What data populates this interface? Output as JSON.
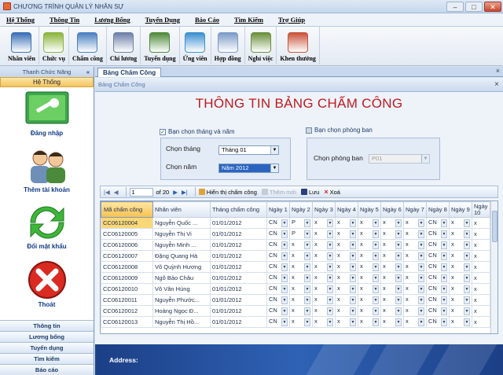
{
  "window": {
    "title": "CHƯƠNG TRÌNH QUẢN LÝ NHÂN SỰ",
    "minimize": "–",
    "maximize": "□",
    "close": "✕"
  },
  "menu": [
    "Hệ Thống",
    "Thông Tin",
    "Lương Bổng",
    "Tuyển Dụng",
    "Báo Cáo",
    "Tìm Kiếm",
    "Trợ Giúp"
  ],
  "toolbar": [
    {
      "label": "Nhân viên",
      "icon": "employee-icon",
      "color": "#3a6fb5"
    },
    {
      "label": "Chức vụ",
      "icon": "position-icon",
      "color": "#8ab43a"
    },
    {
      "label": "Chấm công",
      "icon": "timesheet-icon",
      "color": "#4a7fc1"
    },
    {
      "label": "Chi lương",
      "icon": "payroll-icon",
      "color": "#6d7fa8"
    },
    {
      "label": "Tuyển dụng",
      "icon": "recruitment-icon",
      "color": "#4f8a3a"
    },
    {
      "label": "Ứng viên",
      "icon": "candidate-icon",
      "color": "#3c8fcf"
    },
    {
      "label": "Hợp đồng",
      "icon": "contract-icon",
      "color": "#7c9bc8"
    },
    {
      "label": "Nghỉ việc",
      "icon": "resign-icon",
      "color": "#6a8f3c"
    },
    {
      "label": "Khen thưởng",
      "icon": "reward-icon",
      "color": "#c9533a"
    }
  ],
  "sidebar": {
    "header": "Thanh Chức Năng",
    "collapse": "«",
    "group": "Hệ Thống",
    "items": [
      {
        "label": "Đăng nhập",
        "icon": "login-key-icon"
      },
      {
        "label": "Thêm tài khoản",
        "icon": "add-account-icon"
      },
      {
        "label": "Đổi mật khẩu",
        "icon": "change-password-icon"
      },
      {
        "label": "Thoát",
        "icon": "exit-icon"
      }
    ],
    "categories": [
      "Thông tin",
      "Lương bổng",
      "Tuyển dụng",
      "Tìm kiếm",
      "Báo cáo"
    ]
  },
  "doc_tab": {
    "label": "Bảng Chấm Công",
    "close": "×"
  },
  "panel": {
    "header": "Bảng Chấm Công",
    "title": "THÔNG TIN BẢNG CHẤM CÔNG",
    "month_year": {
      "check_label": "Bạn chọn tháng và năm",
      "checked": true,
      "month_label": "Chọn tháng",
      "month_value": "Tháng 01",
      "year_label": "Chọn năm",
      "year_value": "Năm 2012"
    },
    "department": {
      "check_label": "Bạn chọn phòng ban",
      "checked": false,
      "label": "Chọn phòng ban",
      "value": "P01"
    }
  },
  "navigator": {
    "page": "1",
    "of": "of 20",
    "show_button": "Hiển thị chấm công",
    "add_button": "Thêm mới",
    "save_button": "Lưu",
    "delete_button": "Xoá"
  },
  "grid": {
    "headers": [
      "Mã chấm công",
      "Nhân viên",
      "Tháng chấm công",
      "Ngày 1",
      "Ngày 2",
      "Ngày 3",
      "Ngày 4",
      "Ngày 5",
      "Ngày 6",
      "Ngày 7",
      "Ngày 8",
      "Ngày 9",
      "Ngày 10"
    ],
    "rows": [
      {
        "code": "CC06120004",
        "name": "Nguyễn Quốc ...",
        "month": "01/01/2012",
        "days": [
          "CN",
          "P",
          "x",
          "x",
          "x",
          "x",
          "x",
          "CN",
          "x",
          "x"
        ]
      },
      {
        "code": "CC06120005",
        "name": "Nguyễn Thị Vi",
        "month": "01/01/2012",
        "days": [
          "CN",
          "P",
          "x",
          "x",
          "x",
          "x",
          "x",
          "CN",
          "x",
          "x"
        ]
      },
      {
        "code": "CC06120006",
        "name": "Nguyễn Minh ...",
        "month": "01/01/2012",
        "days": [
          "CN",
          "x",
          "x",
          "x",
          "x",
          "x",
          "x",
          "CN",
          "x",
          "x"
        ]
      },
      {
        "code": "CC06120007",
        "name": "Đặng Quang Hà",
        "month": "01/01/2012",
        "days": [
          "CN",
          "x",
          "x",
          "x",
          "x",
          "x",
          "x",
          "CN",
          "x",
          "x"
        ]
      },
      {
        "code": "CC06120008",
        "name": "Võ Quỳnh Hương",
        "month": "01/01/2012",
        "days": [
          "CN",
          "x",
          "x",
          "x",
          "x",
          "x",
          "x",
          "CN",
          "x",
          "x"
        ]
      },
      {
        "code": "CC06120009",
        "name": "Ngô Bảo Châu",
        "month": "01/01/2012",
        "days": [
          "CN",
          "x",
          "x",
          "x",
          "x",
          "x",
          "x",
          "CN",
          "x",
          "x"
        ]
      },
      {
        "code": "CC06120010",
        "name": "Võ Văn Hùng",
        "month": "01/01/2012",
        "days": [
          "CN",
          "x",
          "x",
          "x",
          "x",
          "x",
          "x",
          "CN",
          "x",
          "x"
        ]
      },
      {
        "code": "CC06120011",
        "name": "Nguyễn Phước...",
        "month": "01/01/2012",
        "days": [
          "CN",
          "x",
          "x",
          "x",
          "x",
          "x",
          "x",
          "CN",
          "x",
          "x"
        ]
      },
      {
        "code": "CC06120012",
        "name": "Hoàng Ngọc Đ...",
        "month": "01/01/2012",
        "days": [
          "CN",
          "x",
          "x",
          "x",
          "x",
          "x",
          "x",
          "CN",
          "x",
          "x"
        ]
      },
      {
        "code": "CC06120013",
        "name": "Nguyễn Thị Hồ...",
        "month": "01/01/2012",
        "days": [
          "CN",
          "x",
          "x",
          "x",
          "x",
          "x",
          "x",
          "CN",
          "x",
          "x"
        ]
      }
    ]
  },
  "footer": {
    "address": "Address:"
  }
}
